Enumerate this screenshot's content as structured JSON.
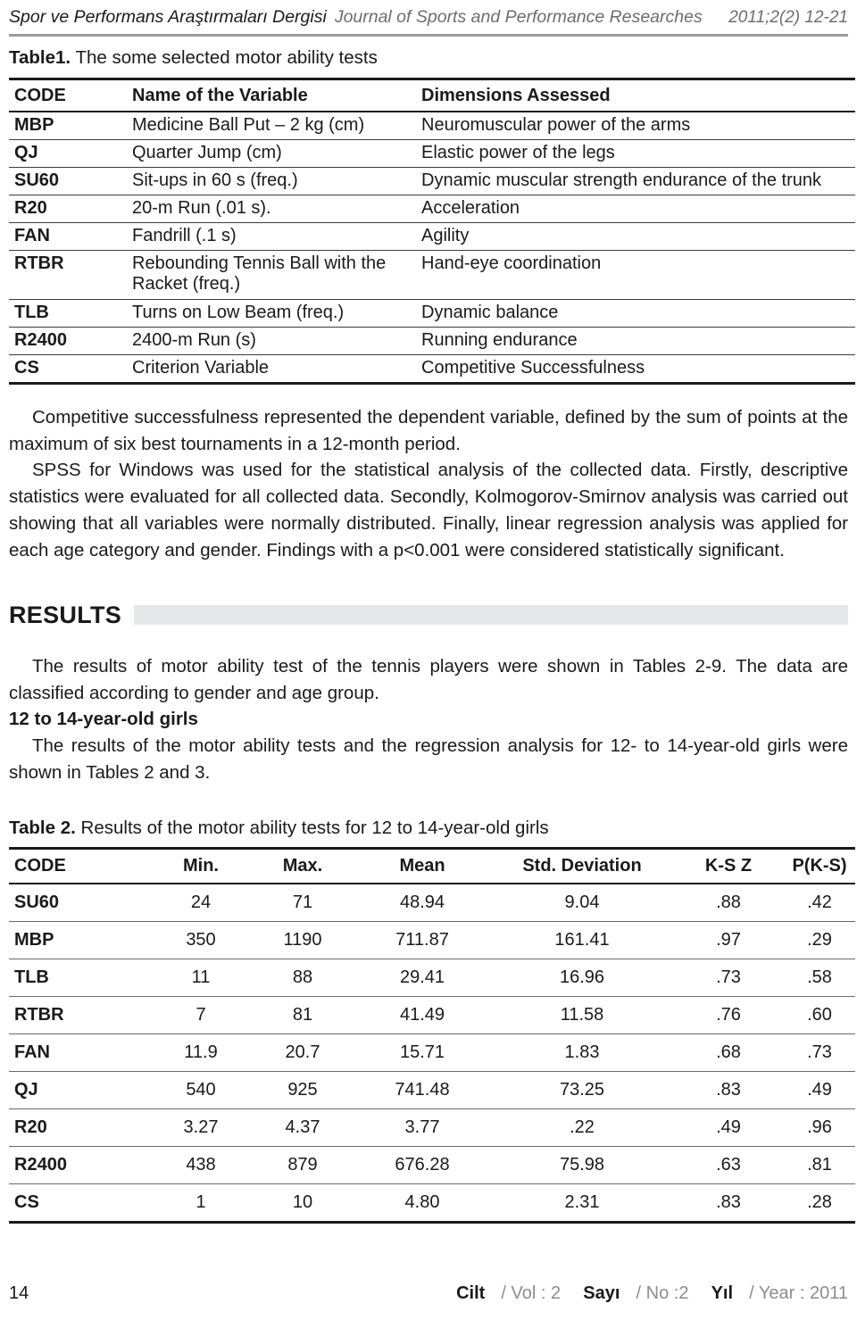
{
  "running_head": {
    "journal_tr": "Spor ve Performans Araştırmaları Dergisi",
    "journal_en": "Journal of Sports and Performance Researches",
    "issue_ref": "2011;2(2) 12-21"
  },
  "table1": {
    "caption_label": "Table1.",
    "caption_text": "The some selected motor ability tests",
    "headers": [
      "CODE",
      "Name of the Variable",
      "Dimensions Assessed"
    ],
    "rows": [
      [
        "MBP",
        "Medicine Ball Put – 2 kg (cm)",
        "Neuromuscular power of the arms"
      ],
      [
        "QJ",
        "Quarter Jump (cm)",
        "Elastic power of the legs"
      ],
      [
        "SU60",
        "Sit-ups in 60 s (freq.)",
        "Dynamic muscular strength endurance of the trunk"
      ],
      [
        "R20",
        "20-m Run (.01 s).",
        "Acceleration"
      ],
      [
        "FAN",
        "Fandrill (.1 s)",
        "Agility"
      ],
      [
        "RTBR",
        "Rebounding Tennis Ball with the Racket (freq.)",
        "Hand-eye coordination"
      ],
      [
        "TLB",
        "Turns on Low Beam (freq.)",
        "Dynamic balance"
      ],
      [
        "R2400",
        "2400-m Run (s)",
        "Running endurance"
      ],
      [
        "CS",
        "Criterion Variable",
        "Competitive Successfulness"
      ]
    ]
  },
  "paragraphs": {
    "p1": "Competitive successfulness represented the dependent variable, defined by the sum of points at the maximum of six best tournaments in a 12-month period.",
    "p2": "SPSS for Windows was used for the statistical analysis of the collected data. Firstly, descriptive statistics were evaluated for all collected data. Secondly, Kolmogorov-Smirnov analysis was carried out showing that all variables were normally distributed. Finally, linear regression analysis was applied for each age category and gender. Findings with a p<0.001 were considered statistically significant.",
    "p3": "The results of motor ability test of the tennis players were shown in Tables 2-9.  The data are classified according to gender and age group.",
    "p4": "The results of the motor ability tests and the regression analysis for 12- to 14-year-old girls were shown in Tables 2 and 3."
  },
  "results_section": {
    "heading": "RESULTS",
    "bar_color": "#e6e7e9"
  },
  "subheading_girls": "12 to 14-year-old girls",
  "table2": {
    "caption_label": "Table 2.",
    "caption_text": "Results of the motor ability tests for 12 to 14-year-old girls",
    "headers": [
      "CODE",
      "Min.",
      "Max.",
      "Mean",
      "Std. Deviation",
      "K-S Z",
      "P(K-S)"
    ],
    "rows": [
      [
        "SU60",
        "24",
        "71",
        "48.94",
        "9.04",
        ".88",
        ".42"
      ],
      [
        "MBP",
        "350",
        "1190",
        "711.87",
        "161.41",
        ".97",
        ".29"
      ],
      [
        "TLB",
        "11",
        "88",
        "29.41",
        "16.96",
        ".73",
        ".58"
      ],
      [
        "RTBR",
        "7",
        "81",
        "41.49",
        "11.58",
        ".76",
        ".60"
      ],
      [
        "FAN",
        "11.9",
        "20.7",
        "15.71",
        "1.83",
        ".68",
        ".73"
      ],
      [
        "QJ",
        "540",
        "925",
        "741.48",
        "73.25",
        ".83",
        ".49"
      ],
      [
        "R20",
        "3.27",
        "4.37",
        "3.77",
        ".22",
        ".49",
        ".96"
      ],
      [
        "R2400",
        "438",
        "879",
        "676.28",
        "75.98",
        ".63",
        ".81"
      ],
      [
        "CS",
        "1",
        "10",
        "4.80",
        "2.31",
        ".83",
        ".28"
      ]
    ]
  },
  "footer": {
    "page_number": "14",
    "volume_tr": "Cilt",
    "volume_en": "/ Vol : 2",
    "number_tr": "Sayı",
    "number_en": "/ No :2",
    "year_tr": "Yıl",
    "year_en": "/ Year : 2011"
  }
}
